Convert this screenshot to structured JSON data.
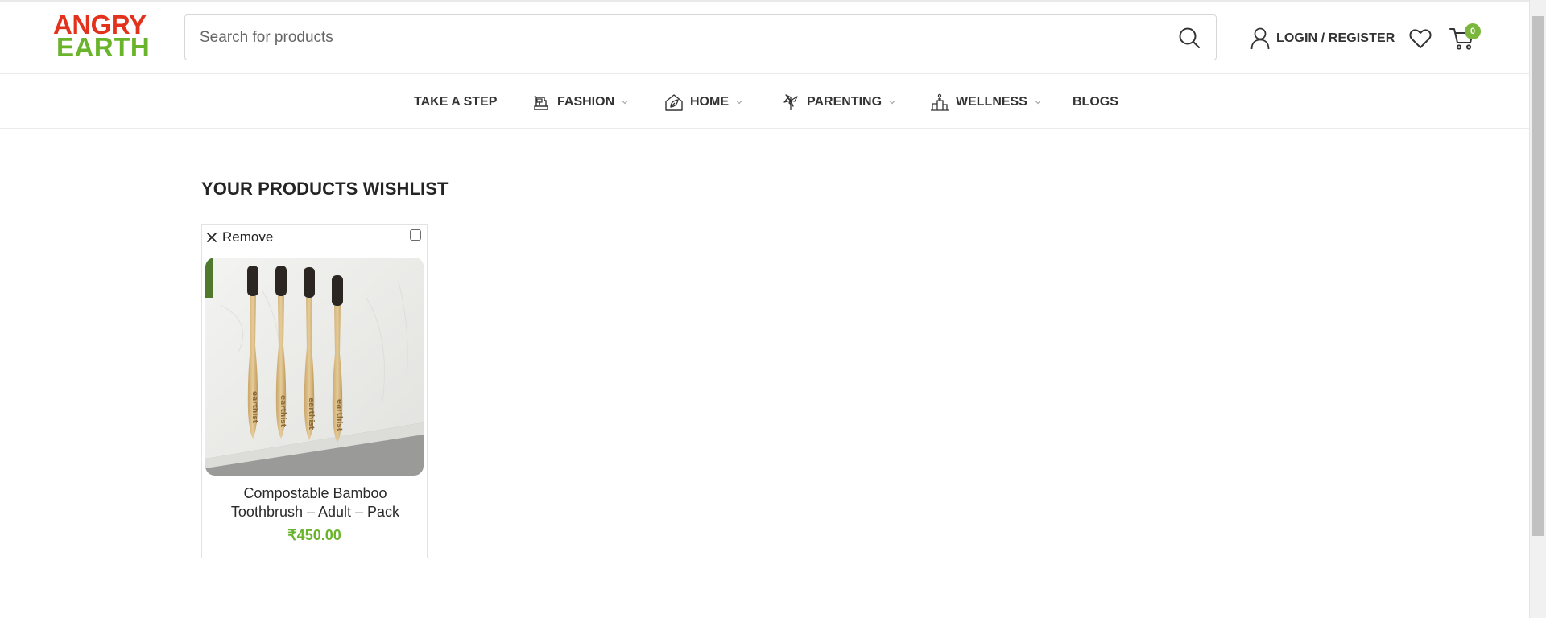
{
  "brand": {
    "line1": "ANGRY",
    "line2": "EARTH",
    "color1": "#e2321c",
    "color2": "#6ab42c"
  },
  "search": {
    "placeholder": "Search for products",
    "value": ""
  },
  "account": {
    "label": "LOGIN / REGISTER"
  },
  "cart": {
    "count": "0"
  },
  "nav": {
    "items": [
      {
        "label": "TAKE A STEP",
        "icon": "",
        "has_dropdown": false
      },
      {
        "label": "FASHION",
        "icon": "sewing-machine-icon",
        "has_dropdown": true
      },
      {
        "label": "HOME",
        "icon": "home-leaf-icon",
        "has_dropdown": true
      },
      {
        "label": "PARENTING",
        "icon": "pinwheel-icon",
        "has_dropdown": true
      },
      {
        "label": "WELLNESS",
        "icon": "wellness-icon",
        "has_dropdown": true
      },
      {
        "label": "BLOGS",
        "icon": "",
        "has_dropdown": false
      }
    ]
  },
  "page": {
    "title": "YOUR PRODUCTS WISHLIST"
  },
  "wishlist": {
    "items": [
      {
        "remove_label": "Remove",
        "name": "Compostable Bamboo Toothbrush – Adult – Pack",
        "price": "₹450.00",
        "image": "bamboo-toothbrushes-photo",
        "brand_marking": "earthist"
      }
    ]
  },
  "colors": {
    "accent": "#6ab42c",
    "badge": "#7ab73b",
    "text": "#333333"
  }
}
